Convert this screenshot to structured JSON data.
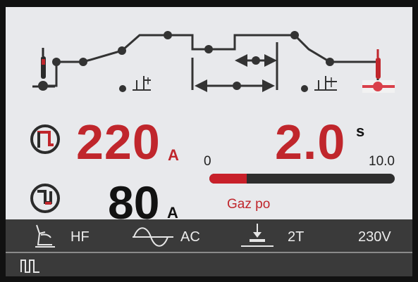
{
  "current": {
    "main_value": "220",
    "main_unit": "A",
    "base_value": "80",
    "base_unit": "A"
  },
  "parameter": {
    "value": "2.0",
    "unit": "s",
    "label": "Gaz po",
    "scale_min": "0",
    "scale_max": "10.0",
    "level": 0.2
  },
  "status_bar": {
    "hf_label": "HF",
    "ac_label": "AC",
    "trigger_label": "2T",
    "voltage_label": "230V"
  },
  "icons": {
    "main_current": "main-current-pulse-icon",
    "base_current": "base-current-pulse-icon",
    "torch": "torch-icon",
    "hf": "hf-ignition-icon",
    "ac": "ac-wave-icon",
    "trigger": "trigger-2t-icon",
    "pulse": "pulse-mode-icon"
  },
  "colors": {
    "accent_red": "#c0262c",
    "screen_bg": "#e8e9ec",
    "status_bg": "#3a3a3a"
  }
}
